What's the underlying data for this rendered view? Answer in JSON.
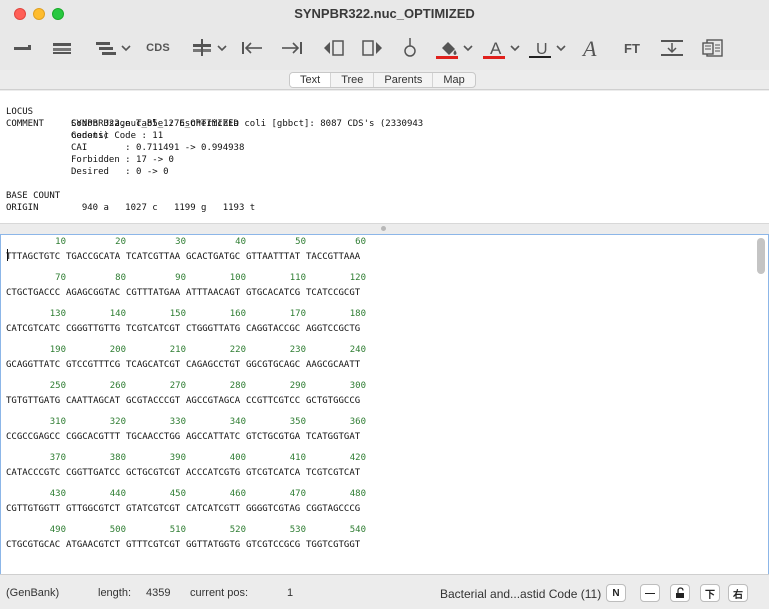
{
  "window": {
    "title": "SYNPBR322.nuc_OPTIMIZED"
  },
  "toolbar": {
    "cds_label": "CDS",
    "ft_label": "FT",
    "highlight_color": "#e0201c",
    "text_color_swatch": "#e0201c",
    "underline_swatch": "#222222"
  },
  "tabs": [
    {
      "label": "Text",
      "active": true
    },
    {
      "label": "Tree",
      "active": false
    },
    {
      "label": "Parents",
      "active": false
    },
    {
      "label": "Map",
      "active": false
    }
  ],
  "header": {
    "locus_key": "LOCUS",
    "locus_value": "SYNPBR322.nuc_85_1276_OPTIMIZED",
    "comment_key": "COMMENT",
    "comment_lines": [
      "Genetic Code : 11",
      "Codon Usage Table : Escherichia coli [gbbct]: 8087 CDS's (2330943",
      "codons)",
      "CAI       : 0.711491 -> 0.994938",
      "Forbidden : 17 -> 0",
      "Desired   : 0 -> 0"
    ],
    "base_count_key": "BASE COUNT",
    "base_count_value": "  940 a   1027 c   1199 g   1193 t",
    "origin_key": "ORIGIN"
  },
  "sequence": {
    "rows": [
      {
        "nums": [
          "10",
          "20",
          "30",
          "40",
          "50",
          "60"
        ],
        "bases": [
          "TTTAGCTGTC",
          "TGACCGCATA",
          "TCATCGTTAA",
          "GCACTGATGC",
          "GTTAATTTAT",
          "TACCGTTAAA"
        ]
      },
      {
        "nums": [
          "70",
          "80",
          "90",
          "100",
          "110",
          "120"
        ],
        "bases": [
          "CTGCTGACCC",
          "AGAGCGGTAC",
          "CGTTTATGAA",
          "ATTTAACAGT",
          "GTGCACATCG",
          "TCATCCGCGT"
        ]
      },
      {
        "nums": [
          "130",
          "140",
          "150",
          "160",
          "170",
          "180"
        ],
        "bases": [
          "CATCGTCATC",
          "CGGGTTGTTG",
          "TCGTCATCGT",
          "CTGGGTTATG",
          "CAGGTACCGC",
          "AGGTCCGCTG"
        ]
      },
      {
        "nums": [
          "190",
          "200",
          "210",
          "220",
          "230",
          "240"
        ],
        "bases": [
          "GCAGGTTATC",
          "GTCCGTTTCG",
          "TCAGCATCGT",
          "CAGAGCCTGT",
          "GGCGTGCAGC",
          "AAGCGCAATT"
        ]
      },
      {
        "nums": [
          "250",
          "260",
          "270",
          "280",
          "290",
          "300"
        ],
        "bases": [
          "TGTGTTGATG",
          "CAATTAGCAT",
          "GCGTACCCGT",
          "AGCCGTAGCA",
          "CCGTTCGTCC",
          "GCTGTGGCCG"
        ]
      },
      {
        "nums": [
          "310",
          "320",
          "330",
          "340",
          "350",
          "360"
        ],
        "bases": [
          "CCGCCGAGCC",
          "CGGCACGTTT",
          "TGCAACCTGG",
          "AGCCATTATC",
          "GTCTGCGTGA",
          "TCATGGTGAT"
        ]
      },
      {
        "nums": [
          "370",
          "380",
          "390",
          "400",
          "410",
          "420"
        ],
        "bases": [
          "CATACCCGTC",
          "CGGTTGATCC",
          "GCTGCGTCGT",
          "ACCCATCGTG",
          "GTCGTCATCA",
          "TCGTCGTCAT"
        ]
      },
      {
        "nums": [
          "430",
          "440",
          "450",
          "460",
          "470",
          "480"
        ],
        "bases": [
          "CGTTGTGGTT",
          "GTTGGCGTCT",
          "GTATCGTCGT",
          "CATCATCGTT",
          "GGGGTCGTAG",
          "CGGTAGCCCG"
        ]
      },
      {
        "nums": [
          "490",
          "500",
          "510",
          "520",
          "530",
          "540"
        ],
        "bases": [
          "CTGCGTGCAC",
          "ATGAACGTCT",
          "GTTTCGTCGT",
          "GGTTATGGTG",
          "GTCGTCCGCG",
          "TGGTCGTGGT"
        ]
      }
    ]
  },
  "status": {
    "format": "(GenBank)",
    "length_label": "length:",
    "length_value": "4359",
    "pos_label": "current pos:",
    "pos_value": "1",
    "code": "Bacterial and...astid Code (11)",
    "btn_n": "N",
    "btn_dash": "—",
    "btn_lock": "🔓",
    "btn_down": "下",
    "btn_right": "右"
  }
}
